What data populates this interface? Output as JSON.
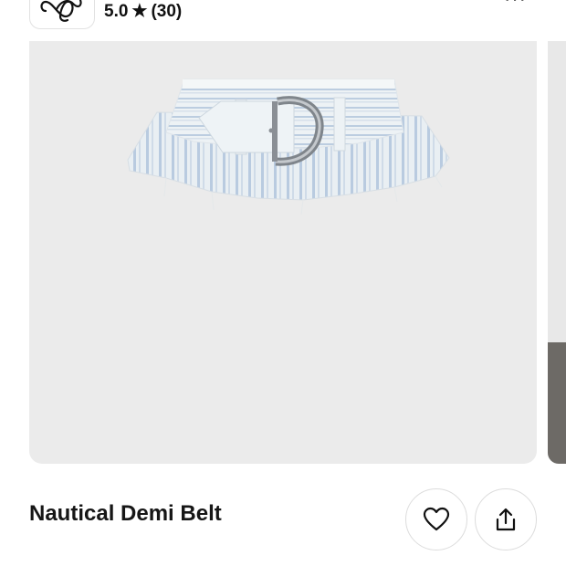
{
  "shop": {
    "logo_icon": "infinity-script-logo-icon",
    "rating": "5.0",
    "star_icon": "star-icon",
    "review_count": "(30)",
    "more_icon": "more-dots-icon"
  },
  "gallery": {
    "image_subject": "striped belt with silver buckle",
    "next_image": "partial next photo"
  },
  "product": {
    "title": "Nautical Demi Belt"
  },
  "actions": {
    "favorite_icon": "heart-icon",
    "share_icon": "share-upload-icon"
  },
  "colors": {
    "image_bg": "#ebebeb",
    "belt_light": "#e6edf2",
    "belt_stripe": "#b9cbe0",
    "buckle": "#8a8f95"
  }
}
